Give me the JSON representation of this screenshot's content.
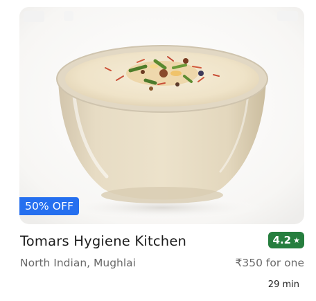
{
  "restaurant_card": {
    "image": {
      "description_icon": "dessert-bowl-image"
    },
    "offer": "50% OFF",
    "name": "Tomars Hygiene Kitchen",
    "rating": {
      "value": "4.2",
      "icon": "star-icon"
    },
    "cuisines": "North Indian, Mughlai",
    "price": "₹350 for one",
    "delivery_time": "29 min"
  },
  "colors": {
    "offer_badge": "#256fef",
    "rating_badge": "#267e3e",
    "primary_text": "#1c1c1c",
    "secondary_text": "#696969"
  }
}
